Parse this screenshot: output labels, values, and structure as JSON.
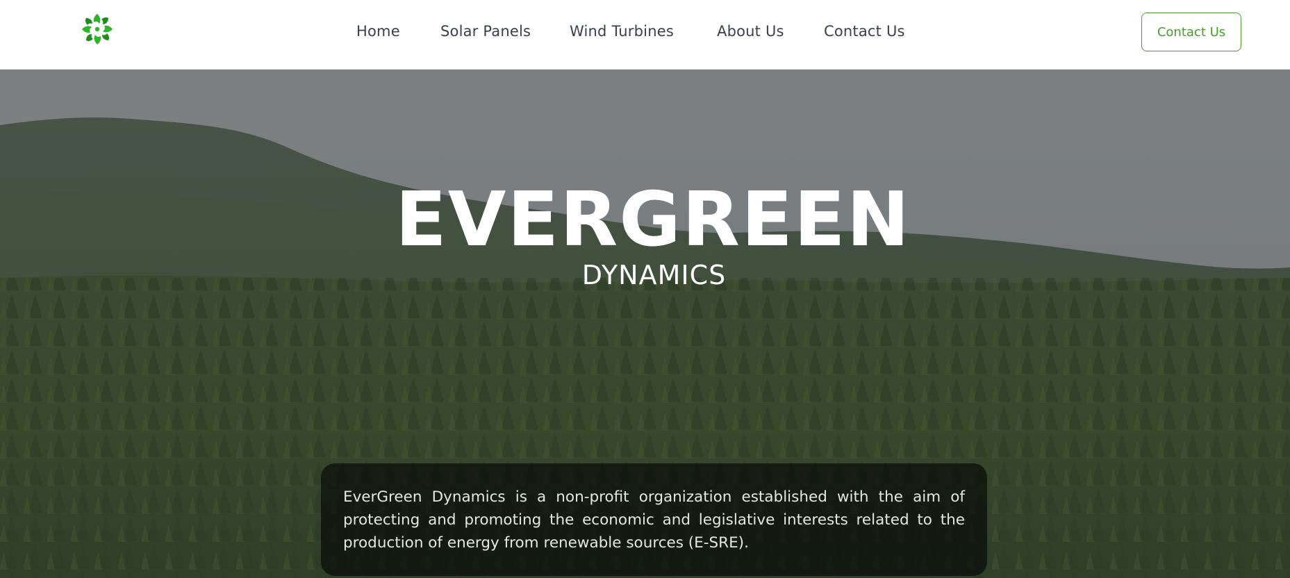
{
  "header": {
    "logo_icon": "leaf-wreath-logo",
    "nav": {
      "home": "Home",
      "solar": "Solar Panels",
      "wind": "Wind Turbines",
      "about": "About Us",
      "contact": "Contact Us"
    },
    "cta_label": "Contact Us"
  },
  "hero": {
    "title": "EVERGREEN",
    "subtitle": "DYNAMICS",
    "description": "EverGreen Dynamics is a non-profit organization established with the aim of protecting and promoting the economic and legislative interests related to the production of energy from renewable sources (E-SRE)."
  },
  "colors": {
    "accent": "#4a9c2a",
    "nav_text": "#3a3f50",
    "logo_green": "#2fb52a"
  }
}
